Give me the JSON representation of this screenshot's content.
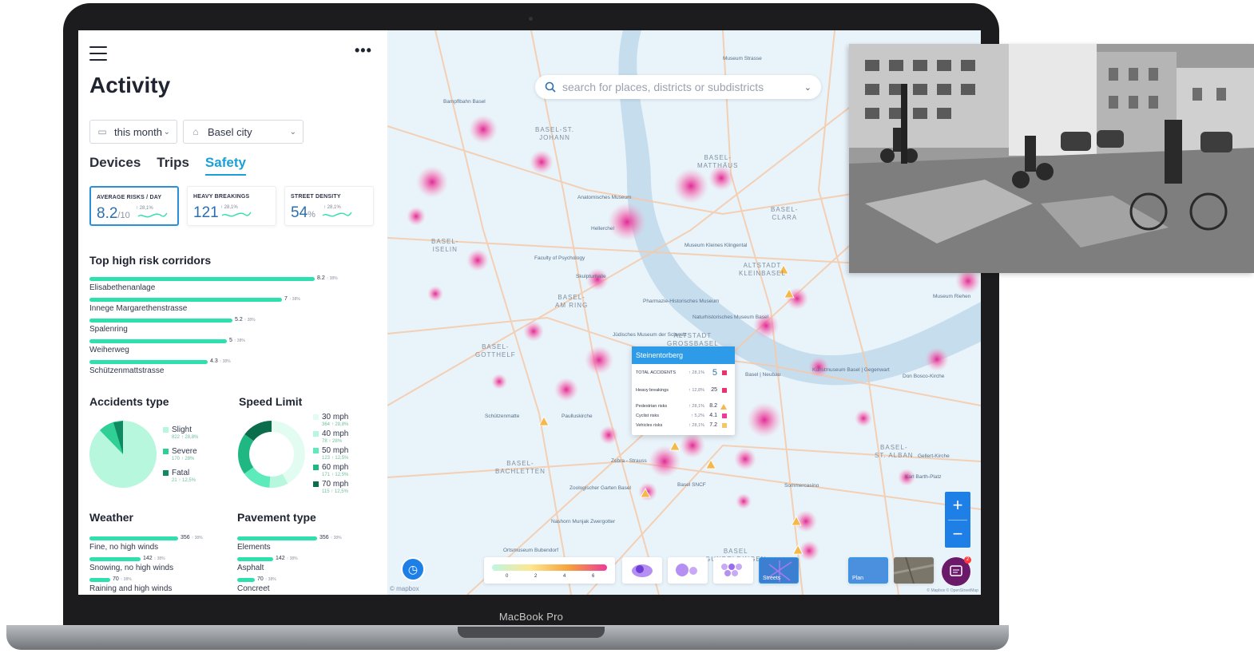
{
  "device": {
    "brand": "MacBook Pro"
  },
  "panel": {
    "title": "Activity",
    "filters": {
      "period": "this month",
      "location": "Basel city"
    },
    "tabs": [
      {
        "label": "Devices",
        "active": false
      },
      {
        "label": "Trips",
        "active": false
      },
      {
        "label": "Safety",
        "active": true
      }
    ],
    "kpis": [
      {
        "label": "AVERAGE RISKS / DAY",
        "value": "8.2",
        "unit": "/10",
        "trend": "↑ 28,1%"
      },
      {
        "label": "HEAVY BREAKINGS",
        "value": "121",
        "unit": "",
        "trend": "↑ 28,1%"
      },
      {
        "label": "STREET DENSITY",
        "value": "54",
        "unit": "%",
        "trend": "↑ 28,1%"
      }
    ],
    "corridors": {
      "title": "Top high risk corridors",
      "items": [
        {
          "name": "Elisabethenanlage",
          "value": "8.2",
          "change": "↑ 38%",
          "fraction": 0.82
        },
        {
          "name": "Innege Margarethenstrasse",
          "value": "7",
          "change": "↑ 38%",
          "fraction": 0.7
        },
        {
          "name": "Spalenring",
          "value": "5.2",
          "change": "↑ 38%",
          "fraction": 0.52
        },
        {
          "name": "Weiherweg",
          "value": "5",
          "change": "↑ 38%",
          "fraction": 0.5
        },
        {
          "name": "Schützenmattstrasse",
          "value": "4.3",
          "change": "↑ 38%",
          "fraction": 0.43
        }
      ]
    },
    "accidents": {
      "title": "Accidents type",
      "items": [
        {
          "label": "Slight",
          "value": "822",
          "change": "↑ 28,8%",
          "color": "#b6f7de"
        },
        {
          "label": "Severe",
          "value": "170",
          "change": "↑ 28%",
          "color": "#2fcf95"
        },
        {
          "label": "Fatal",
          "value": "21",
          "change": "↑ 12,5%",
          "color": "#0f8a60"
        }
      ]
    },
    "speed": {
      "title": "Speed Limit",
      "items": [
        {
          "label": "30 mph",
          "value": "364",
          "change": "↑ 28,8%",
          "color": "#e3fcf2"
        },
        {
          "label": "40 mph",
          "value": "78",
          "change": "↑ 28%",
          "color": "#b6f7de"
        },
        {
          "label": "50 mph",
          "value": "123",
          "change": "↑ 12,5%",
          "color": "#5eebbb"
        },
        {
          "label": "60 mph",
          "value": "171",
          "change": "↑ 12,5%",
          "color": "#1fb883"
        },
        {
          "label": "70 mph",
          "value": "115",
          "change": "↑ 12,5%",
          "color": "#0c6d4c"
        }
      ]
    },
    "weather": {
      "title": "Weather",
      "items": [
        {
          "name": "Fine, no high winds",
          "value": "356",
          "change": "↑ 38%",
          "fraction": 1.0
        },
        {
          "name": "Snowing, no high winds",
          "value": "142",
          "change": "↑ 38%",
          "fraction": 0.58
        },
        {
          "name": "Raining and high winds",
          "value": "70",
          "change": "↑ 38%",
          "fraction": 0.23
        }
      ]
    },
    "pavement": {
      "title": "Pavement type",
      "items": [
        {
          "name": "Elements",
          "value": "356",
          "change": "↑ 38%",
          "fraction": 1.0
        },
        {
          "name": "Asphalt",
          "value": "142",
          "change": "↑ 38%",
          "fraction": 0.45
        },
        {
          "name": "Concreet",
          "value": "70",
          "change": "↑ 38%",
          "fraction": 0.22
        }
      ]
    }
  },
  "map": {
    "search_placeholder": "search for places, districts or subdistricts",
    "districts": [
      {
        "l1": "BASEL-ST.",
        "l2": "JOHANN"
      },
      {
        "l1": "BASEL-",
        "l2": "MATTHÄUS"
      },
      {
        "l1": "BASEL-",
        "l2": "ISELIN"
      },
      {
        "l1": "BASEL-",
        "l2": "AM RING"
      },
      {
        "l1": "ALTSTADT",
        "l2": "KLEINBASEL"
      },
      {
        "l1": "ALTSTADT",
        "l2": "GROSSBASEL"
      },
      {
        "l1": "BASEL-",
        "l2": "GOTTHELF"
      },
      {
        "l1": "BASEL-",
        "l2": "BACHLETTEN"
      },
      {
        "l1": "BASEL-",
        "l2": "ST. ALBAN"
      },
      {
        "l1": "BASEL-",
        "l2": "CLARA"
      },
      {
        "l1": "BASEL",
        "l2": "GUNDELDINGEN"
      }
    ],
    "labels": [
      "Bampflbahn Basel",
      "Anatomisches Museum",
      "Faculty of Psychology",
      "Pharmazie-Historisches Museum",
      "Jüdisches Museum der Schweiz",
      "Naturhistorisches Museum Basel",
      "Museum Kleines Klingental",
      "Basel | Neubau",
      "Kunstmuseum Basel | Gegenwart",
      "Don Bosco-Kirche",
      "Paulluskirche",
      "Zoologischer Garten Basel",
      "Zebra - Strauss",
      "Basel SNCF",
      "Nashorn Munjak Zwergotter",
      "Ortsmuseum Bubendorf",
      "Sommercasino",
      "Gellert-Kirche",
      "Karl Barth-Platz",
      "Museum Riehen",
      "Schützenmatte",
      "Hellerchel",
      "Skulpturhalle",
      "Museum Strasse"
    ],
    "popup": {
      "title": "Steinentorberg",
      "rows": [
        {
          "label": "TOTAL ACCIDENTS",
          "trend": "↑ 28,1%",
          "value": "5",
          "marker": "#e8336f"
        },
        {
          "label": "Heavy breakings",
          "trend": "↑ 12,8%",
          "value": "25",
          "marker": "#e8336f"
        },
        {
          "label": "Pedestrian risks",
          "trend": "↑ 28,1%",
          "value": "8.2",
          "marker": "triangle"
        },
        {
          "label": "Cyclist risks",
          "trend": "↑ 5,2%",
          "value": "4.1",
          "marker": "#ef3a9a"
        },
        {
          "label": "Vehicles risks",
          "trend": "↑ 28,1%",
          "value": "7.2",
          "marker": "#f6c66e"
        }
      ]
    },
    "scale_ticks": [
      "0",
      "2",
      "4",
      "6"
    ],
    "layers": [
      "Streets",
      "Plan"
    ],
    "attribution_left": "© mapbox",
    "attribution_right": "© Mapbox © OpenStreetMap",
    "chat_badge": "2",
    "zoom_in": "+",
    "zoom_out": "−"
  }
}
